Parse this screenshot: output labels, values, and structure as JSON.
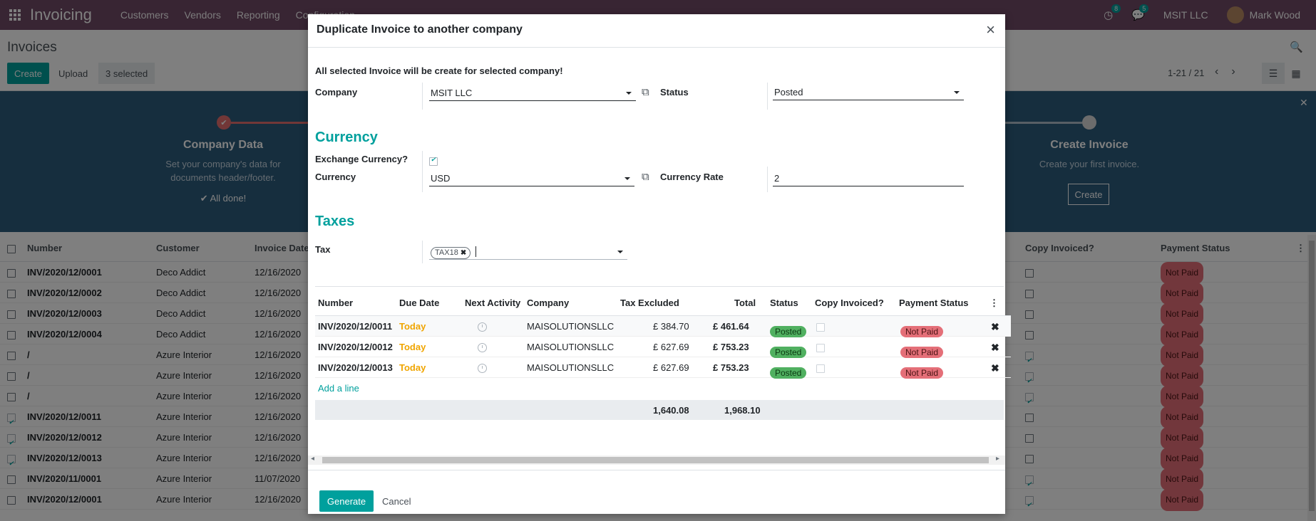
{
  "navbar": {
    "brand": "Invoicing",
    "menus": [
      "Customers",
      "Vendors",
      "Reporting",
      "Configuration"
    ],
    "activity_badge": "8",
    "messages_badge": "5",
    "company": "MSIT LLC",
    "user": "Mark Wood"
  },
  "control_panel": {
    "title": "Invoices",
    "create_label": "Create",
    "upload_label": "Upload",
    "selected_label": "3 selected",
    "pager": "1-21 / 21"
  },
  "banner": {
    "step1_title": "Company Data",
    "step1_desc_1": "Set your company's data for",
    "step1_desc_2": "documents header/footer.",
    "step1_done": "✔ All done!",
    "step_last_title": "Create Invoice",
    "step_last_desc": "Create your first invoice.",
    "step_last_button": "Create"
  },
  "list": {
    "columns": [
      "Number",
      "Customer",
      "Invoice Date",
      "Copy Invoiced?",
      "Payment Status"
    ],
    "rows": [
      {
        "number": "INV/2020/12/0001",
        "customer": "Deco Addict",
        "date": "12/16/2020",
        "selected": false,
        "copy": false,
        "status": "Not Paid"
      },
      {
        "number": "INV/2020/12/0002",
        "customer": "Deco Addict",
        "date": "12/16/2020",
        "selected": false,
        "copy": false,
        "status": "Not Paid"
      },
      {
        "number": "INV/2020/12/0003",
        "customer": "Deco Addict",
        "date": "12/16/2020",
        "selected": false,
        "copy": false,
        "status": "Not Paid"
      },
      {
        "number": "INV/2020/12/0004",
        "customer": "Deco Addict",
        "date": "12/16/2020",
        "selected": false,
        "copy": false,
        "status": "Not Paid"
      },
      {
        "number": "/",
        "customer": "Azure Interior",
        "date": "12/16/2020",
        "selected": false,
        "copy": true,
        "status": "Not Paid"
      },
      {
        "number": "/",
        "customer": "Azure Interior",
        "date": "12/16/2020",
        "selected": false,
        "copy": true,
        "status": "Not Paid"
      },
      {
        "number": "/",
        "customer": "Azure Interior",
        "date": "12/16/2020",
        "selected": false,
        "copy": true,
        "status": "Not Paid"
      },
      {
        "number": "INV/2020/12/0011",
        "customer": "Azure Interior",
        "date": "12/16/2020",
        "selected": true,
        "copy": false,
        "status": "Not Paid"
      },
      {
        "number": "INV/2020/12/0012",
        "customer": "Azure Interior",
        "date": "12/16/2020",
        "selected": true,
        "copy": false,
        "status": "Not Paid"
      },
      {
        "number": "INV/2020/12/0013",
        "customer": "Azure Interior",
        "date": "12/16/2020",
        "selected": true,
        "copy": false,
        "status": "Not Paid"
      },
      {
        "number": "INV/2020/11/0001",
        "customer": "Azure Interior",
        "date": "11/07/2020",
        "selected": false,
        "copy": true,
        "status": "Not Paid"
      },
      {
        "number": "INV/2020/12/0001",
        "customer": "Azure Interior",
        "date": "12/16/2020",
        "selected": false,
        "copy": true,
        "status": "Not Paid"
      }
    ]
  },
  "modal": {
    "title": "Duplicate Invoice to another company",
    "close": "×",
    "warning": "All selected Invoice will be create for selected company!",
    "company_label": "Company",
    "company_value": "MSIT LLC",
    "status_label": "Status",
    "status_value": "Posted",
    "currency_section": "Currency",
    "exchange_label": "Exchange Currency?",
    "currency_label": "Currency",
    "currency_value": "USD",
    "rate_label": "Currency Rate",
    "rate_value": "2",
    "taxes_section": "Taxes",
    "tax_label": "Tax",
    "tax_tag": "TAX18",
    "lines": {
      "columns": [
        "Number",
        "Due Date",
        "Next Activity",
        "Company",
        "Tax Excluded",
        "Total",
        "Status",
        "Copy Invoiced?",
        "Payment Status"
      ],
      "rows": [
        {
          "number": "INV/2020/12/0011",
          "due": "Today",
          "company": "MAISOLUTIONSLLC",
          "tax_excluded": "£ 384.70",
          "total": "£ 461.64",
          "status": "Posted",
          "payment": "Not Paid"
        },
        {
          "number": "INV/2020/12/0012",
          "due": "Today",
          "company": "MAISOLUTIONSLLC",
          "tax_excluded": "£ 627.69",
          "total": "£ 753.23",
          "status": "Posted",
          "payment": "Not Paid"
        },
        {
          "number": "INV/2020/12/0013",
          "due": "Today",
          "company": "MAISOLUTIONSLLC",
          "tax_excluded": "£ 627.69",
          "total": "£ 753.23",
          "status": "Posted",
          "payment": "Not Paid"
        }
      ],
      "add_line": "Add a line",
      "sum_tax_excluded": "1,640.08",
      "sum_total": "1,968.10"
    },
    "generate_label": "Generate",
    "cancel_label": "Cancel"
  }
}
